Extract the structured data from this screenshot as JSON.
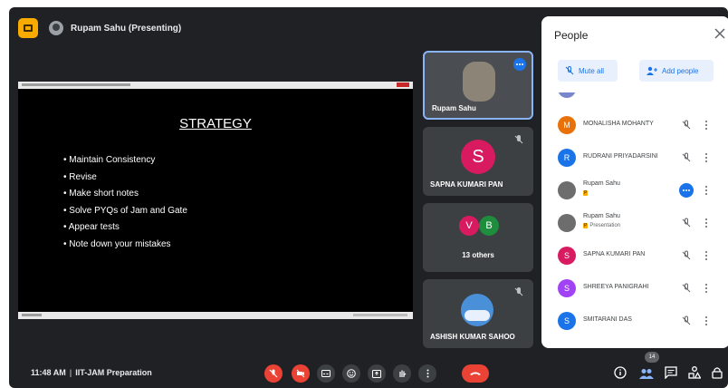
{
  "top_bar": {
    "presenter_label": "Rupam Sahu (Presenting)"
  },
  "slide": {
    "title": "STRATEGY",
    "bullets": [
      "Maintain Consistency",
      "Revise",
      "Make short notes",
      "Solve PYQs of Jam and Gate",
      "Appear tests",
      "Note down your mistakes"
    ]
  },
  "tiles": [
    {
      "name": "Rupam Sahu",
      "pinned": true
    },
    {
      "name": "SAPNA KUMARI PAN",
      "initial": "S",
      "color": "#d81b60",
      "muted": true
    },
    {
      "name": "13 others",
      "initials": [
        "V",
        "B"
      ],
      "colors": [
        "#d81b60",
        "#1e8e3e"
      ]
    },
    {
      "name": "ASHISH KUMAR SAHOO",
      "muted": true
    }
  ],
  "bottom_bar": {
    "time": "11:48 AM",
    "meeting_title": "IIT-JAM Preparation",
    "people_count": "14"
  },
  "people_panel": {
    "title": "People",
    "mute_all_label": "Mute all",
    "add_people_label": "Add people",
    "participants": [
      {
        "name": "MONALISHA MOHANTY",
        "initial": "M",
        "color": "#e8710a"
      },
      {
        "name": "RUDRANI PRIYADARSINI",
        "initial": "R",
        "color": "#1a73e8"
      },
      {
        "name": "Rupam Sahu",
        "badge": "P"
      },
      {
        "name": "Rupam Sahu",
        "sub": "Presentation",
        "badge": "P"
      },
      {
        "name": "SAPNA KUMARI PAN",
        "initial": "S",
        "color": "#d81b60"
      },
      {
        "name": "SHREEYA PANIGRAHI",
        "initial": "S",
        "color": "#a142f4"
      },
      {
        "name": "SMITARANI DAS",
        "initial": "S",
        "color": "#1a73e8"
      }
    ]
  },
  "colors": {
    "accent": "#1a73e8",
    "danger": "#ea4335",
    "bg": "#202124",
    "tile": "#3c4043"
  }
}
